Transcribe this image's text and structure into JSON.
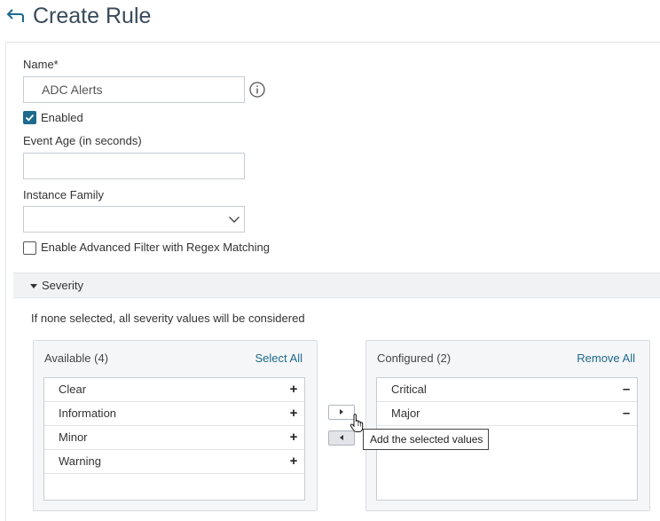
{
  "header": {
    "title": "Create Rule",
    "back_icon": "back-arrow-icon"
  },
  "form": {
    "name_label": "Name*",
    "name_value": "ADC Alerts",
    "info_icon": "info-icon",
    "enabled_label": "Enabled",
    "enabled_checked": true,
    "event_age_label": "Event Age (in seconds)",
    "event_age_value": "",
    "instance_family_label": "Instance Family",
    "instance_family_value": "",
    "advanced_filter_label": "Enable Advanced Filter with Regex Matching",
    "advanced_filter_checked": false
  },
  "severity": {
    "section_title": "Severity",
    "hint": "If none selected, all severity values will be considered",
    "available": {
      "title": "Available (4)",
      "action": "Select All",
      "items": [
        "Clear",
        "Information",
        "Minor",
        "Warning"
      ],
      "item_icon": "+"
    },
    "configured": {
      "title": "Configured (2)",
      "action": "Remove All",
      "items": [
        "Critical",
        "Major"
      ],
      "item_icon": "–"
    },
    "tooltip": "Add the selected values"
  },
  "colors": {
    "accent": "#1d6a8e",
    "title": "#3a4a5b",
    "section_bg": "#f1f2f4"
  }
}
